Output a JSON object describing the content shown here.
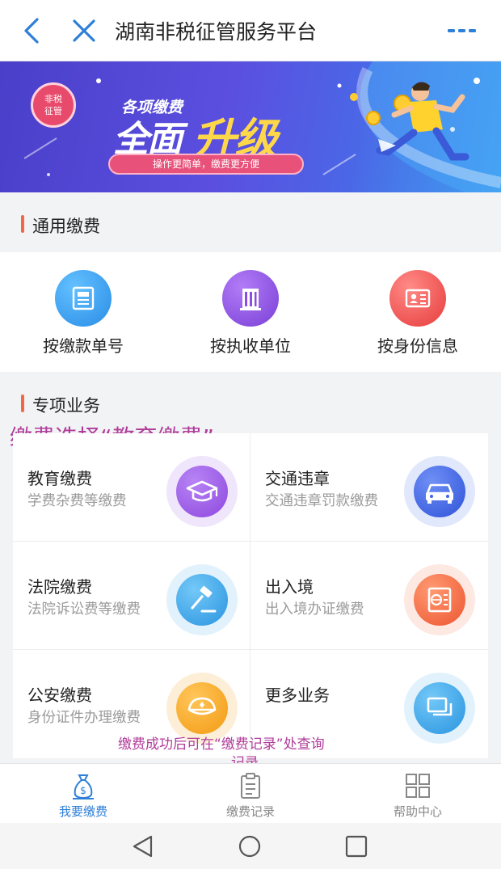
{
  "header": {
    "title": "湖南非税征管服务平台",
    "back_icon": "back-icon",
    "close_icon": "close-icon",
    "more_icon": "more-icon"
  },
  "banner": {
    "seal_line1": "非税",
    "seal_line2": "征管",
    "heading_small": "各项缴费",
    "heading_big1": "全面",
    "heading_big2": "升级",
    "slogan": "操作更简单，缴费更方便"
  },
  "general": {
    "title": "通用缴费",
    "items": [
      {
        "label": "按缴款单号",
        "icon": "document-icon",
        "color": "#3a9ef0"
      },
      {
        "label": "按执收单位",
        "icon": "building-icon",
        "color": "#8a4fe0"
      },
      {
        "label": "按身份信息",
        "icon": "id-card-icon",
        "color": "#f05a5a"
      }
    ]
  },
  "special": {
    "title": "专项业务",
    "items": [
      {
        "title": "教育缴费",
        "desc": "学费杂费等缴费",
        "icon": "graduation-cap-icon",
        "color": "#9a55e6"
      },
      {
        "title": "交通违章",
        "desc": "交通违章罚款缴费",
        "icon": "car-icon",
        "color": "#3d66e8"
      },
      {
        "title": "法院缴费",
        "desc": "法院诉讼费等缴费",
        "icon": "gavel-icon",
        "color": "#3aa8ec"
      },
      {
        "title": "出入境",
        "desc": "出入境办证缴费",
        "icon": "passport-icon",
        "color": "#f0643e"
      },
      {
        "title": "公安缴费",
        "desc": "身份证件办理缴费",
        "icon": "police-cap-icon",
        "color": "#f5a623"
      },
      {
        "title": "更多业务",
        "desc": "",
        "icon": "windows-icon",
        "color": "#3aa8ec"
      }
    ]
  },
  "annotations": {
    "choose": "缴费选择“教育缴费”",
    "after_line1": "缴费成功后可在“缴费记录”处查询",
    "after_line2": "记录"
  },
  "tabbar": {
    "items": [
      {
        "label": "我要缴费",
        "icon": "money-bag-icon",
        "active": true
      },
      {
        "label": "缴费记录",
        "icon": "clipboard-icon",
        "active": false
      },
      {
        "label": "帮助中心",
        "icon": "grid-icon",
        "active": false
      }
    ],
    "active_color": "#2f7fd8",
    "inactive_color": "#888888"
  },
  "system_nav": {
    "back": "nav-back-icon",
    "home": "nav-home-icon",
    "recents": "nav-recents-icon"
  }
}
